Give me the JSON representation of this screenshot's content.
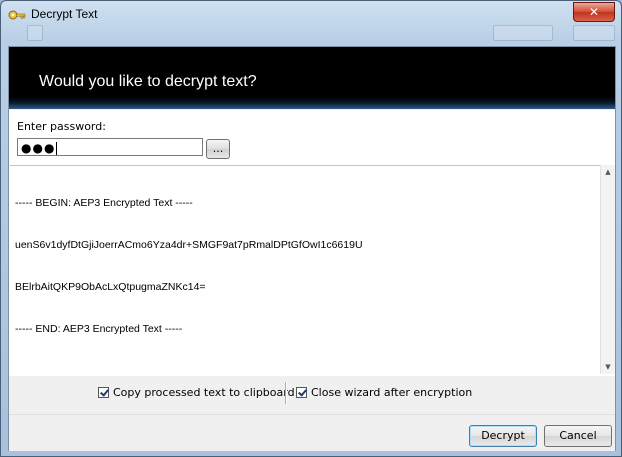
{
  "window": {
    "title": "Decrypt Text",
    "title_icon": "key-icon",
    "close_glyph": "✕"
  },
  "banner": {
    "heading": "Would you like to decrypt text?"
  },
  "password": {
    "label": "Enter password:",
    "masked_value": "●●●",
    "browse_label": "..."
  },
  "text": {
    "lines": [
      "----- BEGIN: AEP3 Encrypted Text -----",
      "uenS6v1dyfDtGjiJoerrACmo6Yza4dr+SMGF9at7pRmalDPtGfOwI1c6619U",
      "BElrbAitQKP9ObAcLxQtpugmaZNKc14=",
      "----- END: AEP3 Encrypted Text -----"
    ]
  },
  "options": {
    "copy_label": "Copy processed text to clipboard",
    "copy_checked": true,
    "close_label": "Close wizard after encryption",
    "close_checked": true
  },
  "buttons": {
    "decrypt": "Decrypt",
    "cancel": "Cancel"
  },
  "colors": {
    "banner_bg": "#000000",
    "window_frame": "#b9cfe6",
    "primary_border": "#3c7fb1"
  }
}
